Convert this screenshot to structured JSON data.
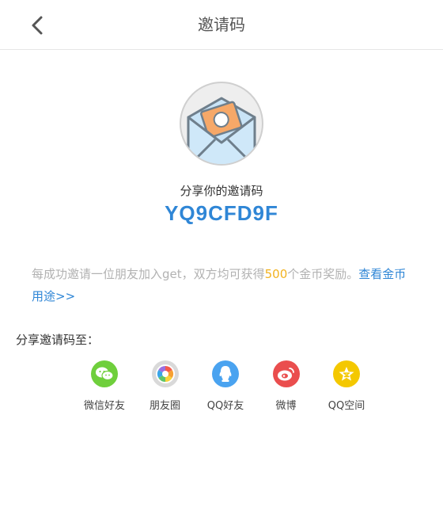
{
  "header": {
    "title": "邀请码",
    "back_icon": "chevron-left-icon"
  },
  "hero": {
    "icon": "envelope-money-icon"
  },
  "invite": {
    "label": "分享你的邀请码",
    "code": "YQ9CFD9F"
  },
  "description": {
    "prefix": "每成功邀请一位朋友加入get，双方均可获得",
    "amount": "500",
    "suffix": "个金币奖励。",
    "link": "查看金币用途>>"
  },
  "share": {
    "heading": "分享邀请码至：",
    "targets": [
      {
        "label": "微信好友",
        "icon": "wechat-icon",
        "color": "#6fcf3c"
      },
      {
        "label": "朋友圈",
        "icon": "moments-icon",
        "color": "#cccccc"
      },
      {
        "label": "QQ好友",
        "icon": "qq-icon",
        "color": "#4aa3f0"
      },
      {
        "label": "微博",
        "icon": "weibo-icon",
        "color": "#ea4e4e"
      },
      {
        "label": "QQ空间",
        "icon": "qzone-icon",
        "color": "#f4c800"
      }
    ]
  },
  "colors": {
    "accent": "#2f86d6",
    "highlight": "#f2b21f",
    "muted": "#b2b2b2"
  }
}
